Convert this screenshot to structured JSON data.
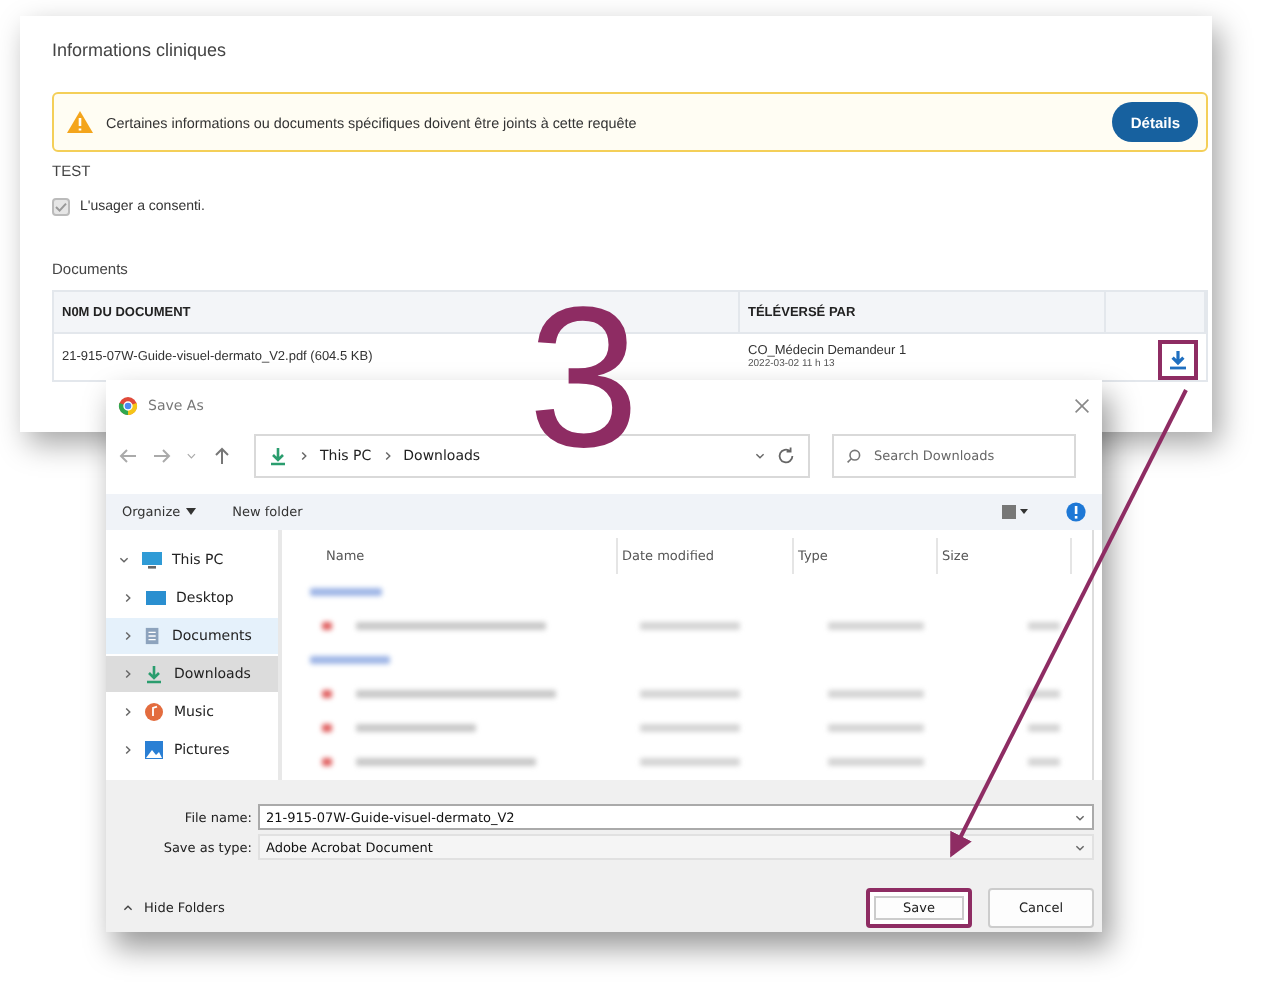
{
  "panel": {
    "title": "Informations cliniques",
    "alert": {
      "message": "Certaines informations ou documents spécifiques doivent être joints à cette requête",
      "button": "Détails"
    },
    "section_label": "TEST",
    "consent": {
      "label": "L'usager a consenti.",
      "checked": true,
      "disabled": true
    },
    "documents": {
      "title": "Documents",
      "columns": [
        "N0M DU DOCUMENT",
        "TÉLÉVERSÉ PAR"
      ],
      "rows": [
        {
          "name": "21-915-07W-Guide-visuel-dermato_V2.pdf (604.5 KB)",
          "uploader": "CO_Médecin Demandeur 1",
          "date": "2022-03-02 11 h 13",
          "download_highlighted": true
        }
      ]
    }
  },
  "dialog": {
    "title": "Save As",
    "breadcrumb": [
      "This PC",
      "Downloads"
    ],
    "search": {
      "placeholder": "Search Downloads"
    },
    "toolbar": [
      {
        "label": "Organize",
        "dropdown": true
      },
      {
        "label": "New folder",
        "dropdown": false
      }
    ],
    "nav": [
      {
        "label": "This PC",
        "kind": "pc",
        "expanded": true,
        "selected": false,
        "hovered": false,
        "children": [
          {
            "label": "Desktop",
            "kind": "desktop",
            "expanded": false,
            "selected": false,
            "hovered": false
          },
          {
            "label": "Documents",
            "kind": "documents",
            "expanded": false,
            "selected": false,
            "hovered": true
          },
          {
            "label": "Downloads",
            "kind": "downloads",
            "expanded": false,
            "selected": true,
            "hovered": false
          },
          {
            "label": "Music",
            "kind": "music",
            "expanded": false,
            "selected": false,
            "hovered": false
          },
          {
            "label": "Pictures",
            "kind": "pictures",
            "expanded": false,
            "selected": false,
            "hovered": false
          }
        ]
      }
    ],
    "columns": [
      "Name",
      "Date modified",
      "Type",
      "Size"
    ],
    "file_name": {
      "label": "File name:",
      "value": "21-915-07W-Guide-visuel-dermato_V2"
    },
    "save_as_type": {
      "label": "Save as type:",
      "value": "Adobe Acrobat Document"
    },
    "buttons": [
      {
        "label": "Save",
        "highlighted": true
      },
      {
        "label": "Cancel",
        "highlighted": false
      }
    ],
    "hide_folders": "Hide Folders"
  },
  "annotation": {
    "step": "3"
  }
}
